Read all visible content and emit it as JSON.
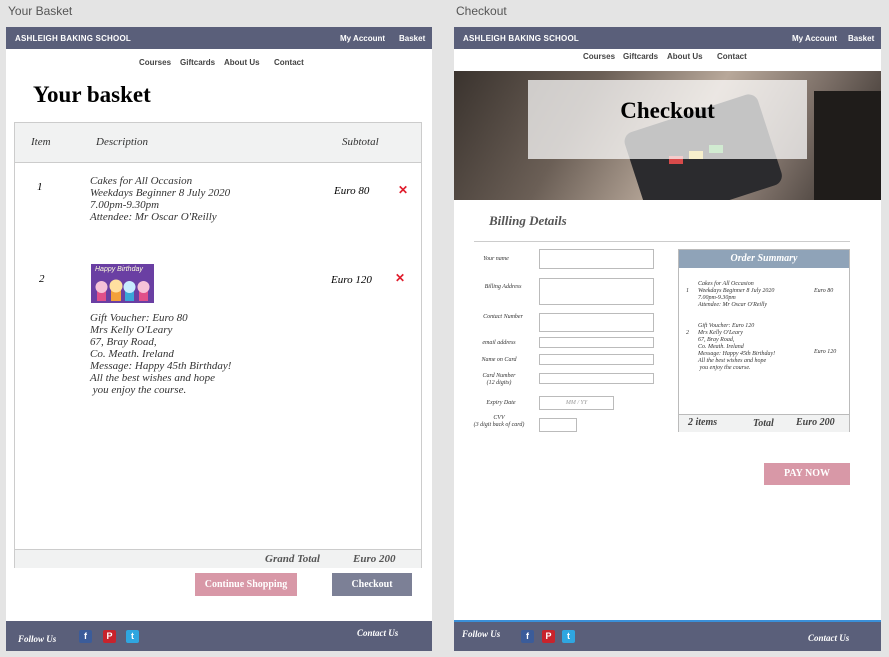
{
  "artboards": {
    "basket_label": "Your Basket",
    "checkout_label": "Checkout"
  },
  "site": {
    "brand": "ASHLEIGH BAKING SCHOOL",
    "my_account": "My Account",
    "basket": "Basket",
    "nav": [
      "Courses",
      "Giftcards",
      "About Us",
      "Contact"
    ],
    "follow_us": "Follow Us",
    "contact_us": "Contact Us",
    "social_icons": [
      "facebook-icon",
      "pinterest-icon",
      "twitter-icon"
    ],
    "colors": {
      "header": "#5a5f7a",
      "accent_pink": "#d898a7",
      "button_grey": "#7c8096",
      "remove_red": "#e01b2b",
      "summary_header": "#8fa3b8"
    }
  },
  "basket": {
    "title": "Your basket",
    "columns": {
      "item": "Item",
      "description": "Description",
      "subtotal": "Subtotal"
    },
    "rows": [
      {
        "item": "1",
        "lines": [
          "Cakes for All Occasion",
          "Weekdays Beginner 8 July 2020",
          "7.00pm-9.30pm",
          "Attendee: Mr Oscar O'Reilly"
        ],
        "subtotal": "Euro 80"
      },
      {
        "item": "2",
        "card_text": "Happy Birthday",
        "lines": [
          "Gift Voucher: Euro 80",
          "Mrs Kelly O'Leary",
          "67, Bray Road,",
          "Co. Meath. Ireland",
          "Message: Happy 45th Birthday!",
          "All the best wishes and hope",
          " you enjoy the course."
        ],
        "subtotal": "Euro 120"
      }
    ],
    "grand_total_label": "Grand Total",
    "grand_total": "Euro 200",
    "continue_button": "Continue Shopping",
    "checkout_button": "Checkout"
  },
  "checkout": {
    "hero_title": "Checkout",
    "billing_title": "Billing Details",
    "fields": [
      {
        "label": "Your name"
      },
      {
        "label": "Billing Address"
      },
      {
        "label": "Contact Number"
      },
      {
        "label": "email address"
      },
      {
        "label": "Name on Card"
      },
      {
        "label": "Card Number\n(12 digits)"
      },
      {
        "label": "Expiry Date",
        "placeholder": "MM / YY"
      },
      {
        "label": "CVV\n(3 digit back of card)"
      }
    ],
    "summary": {
      "title": "Order Summary",
      "rows": [
        {
          "item": "1",
          "text": "Cakes for All Occasion\nWeekdays Beginner 8 July 2020\n7.00pm-9.30pm\nAttendee: Mr Oscar O'Reilly",
          "price": "Euro 80"
        },
        {
          "item": "2",
          "text": "Gift Voucher: Euro 120\nMrs Kelly O'Leary\n67, Bray Road,\nCo. Meath. Ireland\nMessage: Happy 45th Birthday!\nAll the best wishes and hope\n you enjoy the course.",
          "price": "Euro 120"
        }
      ],
      "items_count": "2 items",
      "total_label": "Total",
      "total": "Euro 200"
    },
    "pay_button": "PAY NOW"
  }
}
